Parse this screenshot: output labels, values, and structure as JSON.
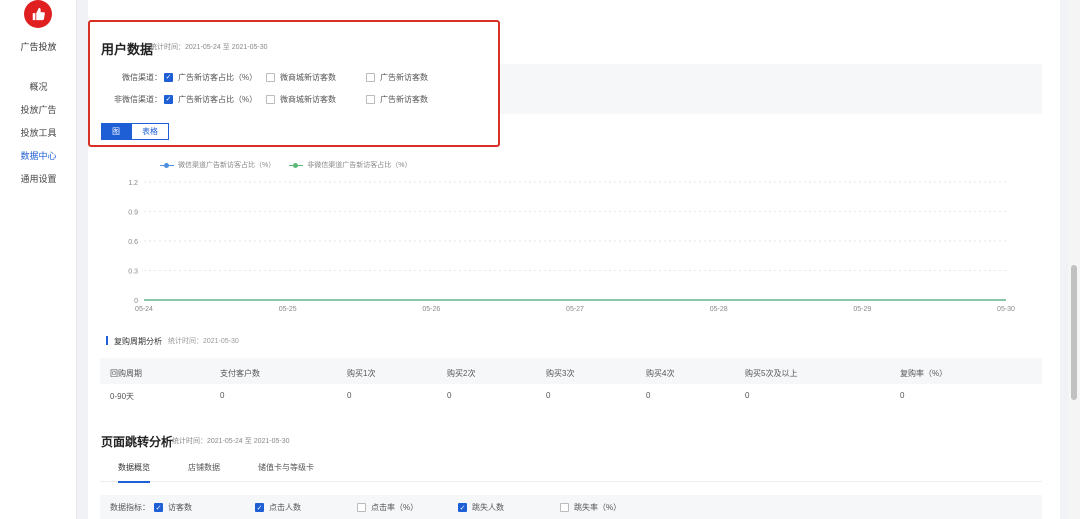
{
  "sidebar": {
    "logo_icon": "thumbs-up-icon",
    "logo_label": "广告投放",
    "items": [
      {
        "label": "概况"
      },
      {
        "label": "投放广告"
      },
      {
        "label": "投放工具"
      },
      {
        "label": "数据中心",
        "active": true
      },
      {
        "label": "通用设置"
      }
    ]
  },
  "user_data": {
    "title": "用户数据",
    "stat_time": "统计时间：2021-05-24 至 2021-05-30",
    "wechat_label": "微信渠道：",
    "nonwechat_label": "非微信渠道：",
    "options": {
      "ad_new_ratio": "广告新访客占比（%）",
      "mall_new": "微商城新访客数",
      "ad_new": "广告新访客数"
    },
    "view_graph": "图",
    "view_table": "表格"
  },
  "chart_data": {
    "type": "line",
    "categories": [
      "05-24",
      "05-25",
      "05-26",
      "05-27",
      "05-28",
      "05-29",
      "05-30"
    ],
    "series": [
      {
        "name": "微信渠道广告新访客占比（%）",
        "values": [
          0,
          0,
          0,
          0,
          0,
          0,
          0
        ],
        "color": "#4a90e2"
      },
      {
        "name": "非微信渠道广告新访客占比（%）",
        "values": [
          0,
          0,
          0,
          0,
          0,
          0,
          0
        ],
        "color": "#5cb87a"
      }
    ],
    "yticks": [
      "0",
      "0.3",
      "0.6",
      "0.9",
      "1.2"
    ],
    "ylim": [
      0,
      1.2
    ]
  },
  "repurchase": {
    "title": "复购周期分析",
    "stat_time": "统计时间：2021-05-30",
    "headers": [
      "回购周期",
      "支付客户数",
      "购买1次",
      "购买2次",
      "购买3次",
      "购买4次",
      "购买5次及以上",
      "复购率（%）"
    ],
    "row": [
      "0-90天",
      "0",
      "0",
      "0",
      "0",
      "0",
      "0",
      "0"
    ]
  },
  "page_jump": {
    "title": "页面跳转分析",
    "stat_time": "统计时间：2021-05-24 至 2021-05-30",
    "tabs": [
      "数据概览",
      "店铺数据",
      "储值卡与等级卡"
    ],
    "metric_label": "数据指标：",
    "metrics": [
      "访客数",
      "点击人数",
      "点击率（%）",
      "跳失人数",
      "跳失率（%）"
    ]
  },
  "colors": {
    "accent": "#1f5fd6",
    "highlight_border": "#d93025",
    "logo_red": "#e02020"
  }
}
